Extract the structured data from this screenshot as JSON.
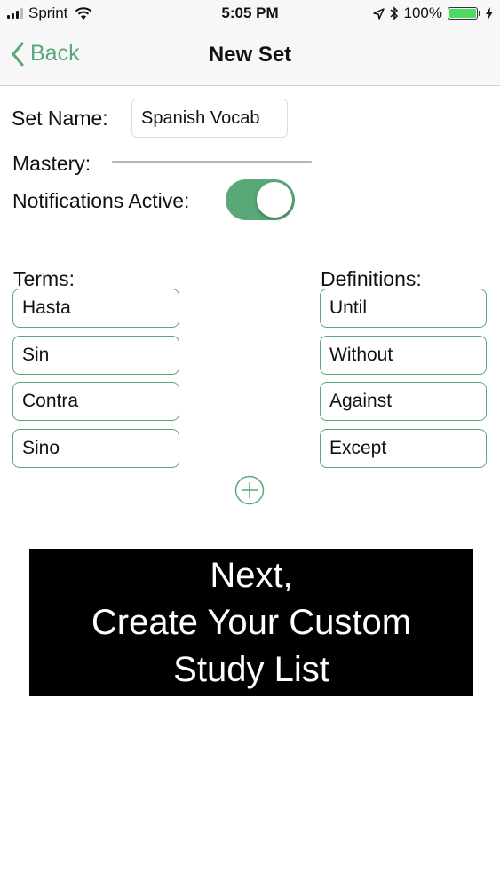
{
  "status_bar": {
    "carrier": "Sprint",
    "time": "5:05 PM",
    "battery_percent": "100%",
    "battery_level": 1.0,
    "icons": [
      "signal-icon",
      "wifi-icon",
      "location-icon",
      "bluetooth-icon",
      "battery-icon",
      "charging-icon"
    ]
  },
  "nav": {
    "back_label": "Back",
    "title": "New Set"
  },
  "form": {
    "set_name_label": "Set Name:",
    "set_name_value": "Spanish Vocab",
    "mastery_label": "Mastery:",
    "mastery_value": 0,
    "notifications_label": "Notifications Active:",
    "notifications_on": true
  },
  "terms": {
    "header": "Terms:",
    "items": [
      "Hasta",
      "Sin",
      "Contra",
      "Sino"
    ]
  },
  "definitions": {
    "header": "Definitions:",
    "items": [
      "Until",
      "Without",
      "Against",
      "Except"
    ]
  },
  "banner": {
    "lines": [
      "Next,",
      "Create Your Custom",
      "Study List"
    ]
  },
  "colors": {
    "accent": "#5aa878",
    "banner_bg": "#000000",
    "banner_text": "#ffffff"
  }
}
